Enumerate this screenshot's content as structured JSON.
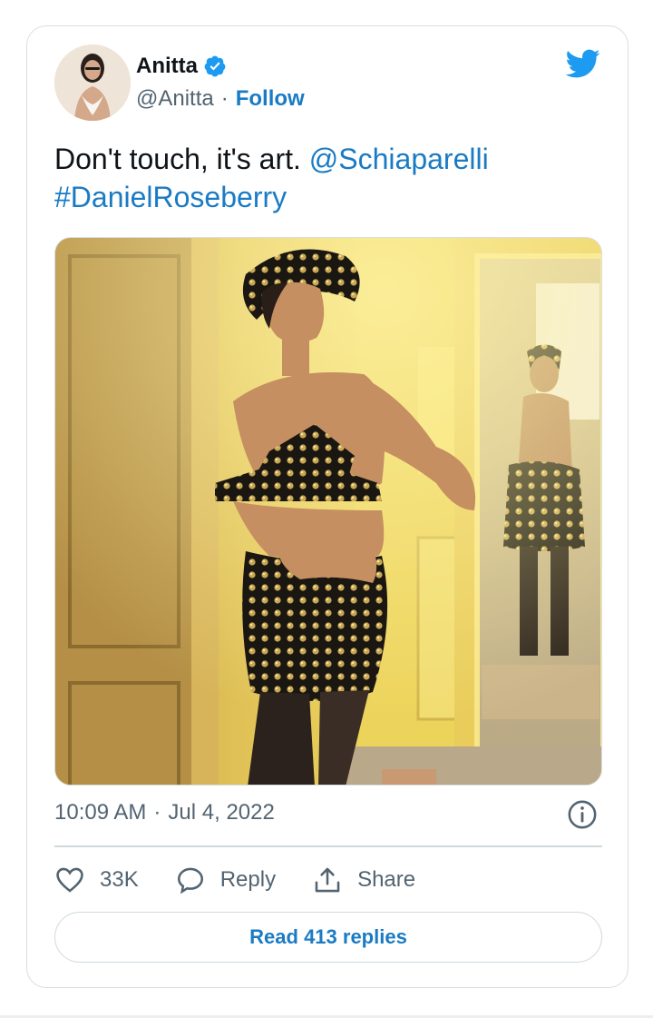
{
  "author": {
    "name": "Anitta",
    "handle": "@Anitta",
    "separator": "·",
    "follow_label": "Follow",
    "verified": true
  },
  "tweet": {
    "text": "Don't touch, it's art.",
    "mention": "@Schiaparelli",
    "hashtag": "#DanielRoseberry",
    "photo_icon": "photo"
  },
  "meta": {
    "time": "10:09 AM",
    "separator": "·",
    "date": "Jul 4, 2022"
  },
  "actions": {
    "likes": "33K",
    "reply_label": "Reply",
    "share_label": "Share"
  },
  "read_replies_label": "Read 413 replies",
  "icons": {
    "brand": "twitter-bird-icon",
    "verified": "verified-badge-icon",
    "info": "info-icon",
    "like": "heart-icon",
    "reply": "reply-bubble-icon",
    "share": "share-icon"
  },
  "colors": {
    "brand_blue": "#1d9bf0",
    "link_blue": "#1a7bc4",
    "text": "#0f1419",
    "secondary": "#536471",
    "border": "#cfd9de"
  }
}
